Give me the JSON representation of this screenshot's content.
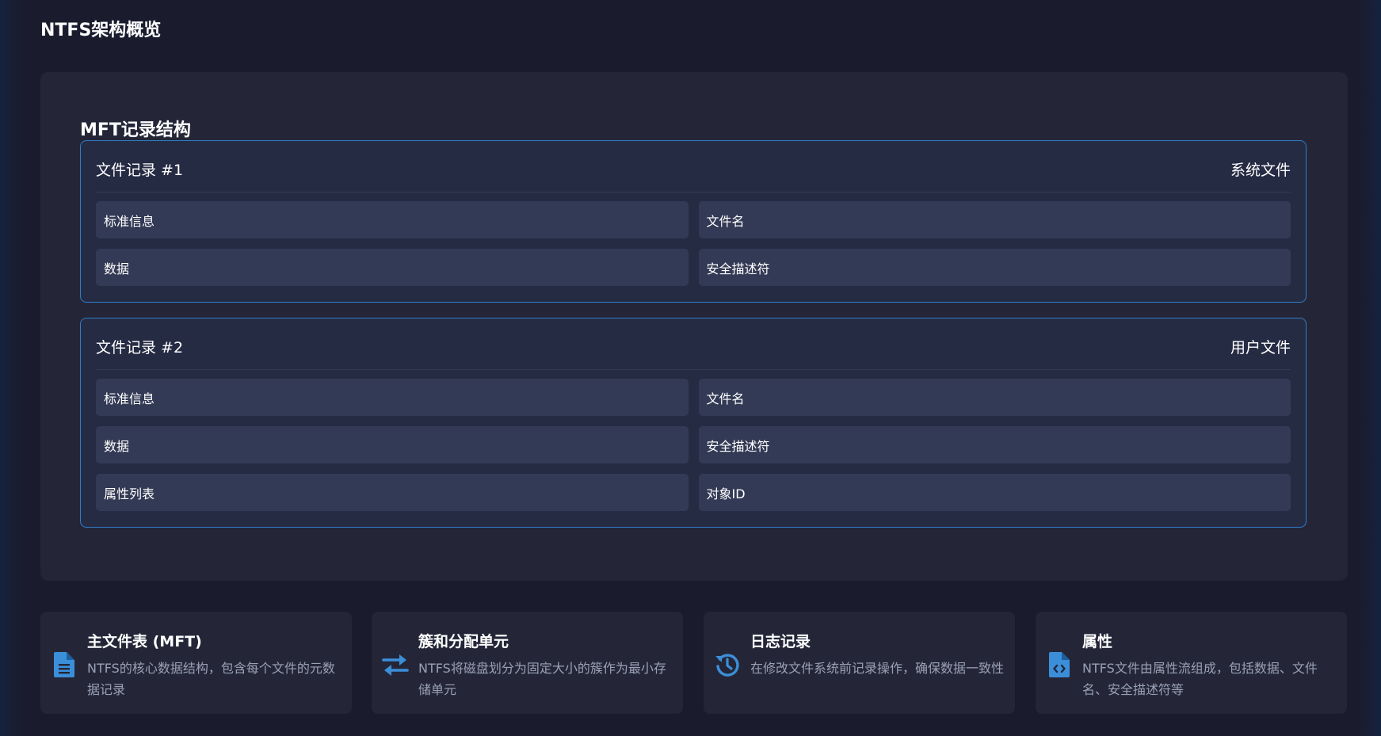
{
  "page": {
    "title": "NTFS架构概览"
  },
  "mft": {
    "section_title": "MFT记录结构",
    "records": [
      {
        "name": "文件记录 #1",
        "type": "系统文件",
        "attributes": [
          "标准信息",
          "文件名",
          "数据",
          "安全描述符"
        ]
      },
      {
        "name": "文件记录 #2",
        "type": "用户文件",
        "attributes": [
          "标准信息",
          "文件名",
          "数据",
          "安全描述符",
          "属性列表",
          "对象ID"
        ]
      }
    ]
  },
  "cards": [
    {
      "icon": "file-text-icon",
      "title": "主文件表 (MFT)",
      "description": "NTFS的核心数据结构，包含每个文件的元数据记录"
    },
    {
      "icon": "exchange-arrows-icon",
      "title": "簇和分配单元",
      "description": "NTFS将磁盘划分为固定大小的簇作为最小存储单元"
    },
    {
      "icon": "history-icon",
      "title": "日志记录",
      "description": "在修改文件系统前记录操作，确保数据一致性"
    },
    {
      "icon": "file-code-icon",
      "title": "属性",
      "description": "NTFS文件由属性流组成，包括数据、文件名、安全描述符等"
    }
  ],
  "colors": {
    "background": "#1a1c2e",
    "panel": "#242638",
    "record_bg": "#262b44",
    "record_border": "#2f7cc4",
    "attribute_bg": "#333a55",
    "icon_accent": "#3b8fd9",
    "muted_text": "#9aa0b4"
  }
}
